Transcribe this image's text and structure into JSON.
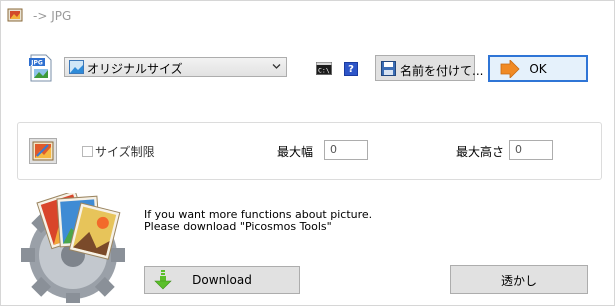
{
  "window": {
    "title": "-> JPG"
  },
  "format": {
    "selected": "オリジナルサイズ"
  },
  "toolbar": {
    "help_label": "?",
    "save_as_label": "名前を付けて...",
    "ok_label": "OK"
  },
  "size_limit": {
    "checkbox_label": "サイズ制限",
    "checked": false,
    "max_width_label": "最大幅",
    "max_width_value": "0",
    "max_height_label": "最大高さ",
    "max_height_value": "0"
  },
  "promo": {
    "text": "If you want more functions about picture.\nPlease download \"Picosmos Tools\"",
    "download_label": "Download",
    "watermark_label": "透かし"
  },
  "icons": {
    "app": "app-icon",
    "jpg_file": "jpg-file-icon",
    "select_image": "image-icon",
    "cmd": "command-prompt-icon",
    "help": "help-icon",
    "save": "floppy-disk-icon",
    "ok": "arrow-right-icon",
    "picture": "picture-edit-icon",
    "logo": "picosmos-logo",
    "download": "download-arrow-icon"
  },
  "colors": {
    "ok_border": "#2f75d6",
    "help_blue": "#2d55c8",
    "arrow_orange": "#f08a24",
    "download_green": "#5bbf2a"
  }
}
